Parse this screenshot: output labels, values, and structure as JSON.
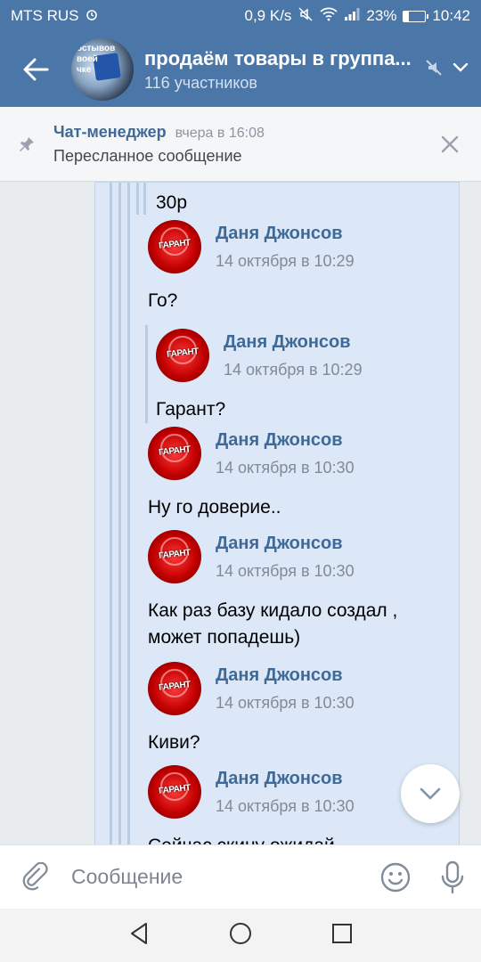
{
  "status_bar": {
    "carrier": "MTS RUS",
    "speed": "0,9 K/s",
    "battery": "23%",
    "battery_level": 0.23,
    "time": "10:42"
  },
  "header": {
    "title": "продаём товары в группа...",
    "subtitle": "116 участников",
    "avatar_text": "остывов\nвоей\nчке"
  },
  "pinned": {
    "author": "Чат-менеджер",
    "time": "вчера в 16:08",
    "text": "Пересланное сообщение"
  },
  "avatar_label": "ГАРАНТ",
  "messages": [
    {
      "text": "30р"
    },
    {
      "author": "Даня Джонсов",
      "time": "14 октября в 10:29",
      "text": "Го?"
    },
    {
      "author": "Даня Джонсов",
      "time": "14 октября в 10:29",
      "text": "Гарант?"
    },
    {
      "author": "Даня Джонсов",
      "time": "14 октября в 10:30",
      "text": "Ну го доверие.."
    },
    {
      "author": "Даня Джонсов",
      "time": "14 октября в 10:30",
      "text_line1": "Как раз базу кидало создал ,",
      "text_line2": "может попадешь)"
    },
    {
      "author": "Даня Джонсов",
      "time": "14 октября в 10:30",
      "text": "Киви?"
    },
    {
      "author": "Даня Джонсов",
      "time": "14 октября в 10:30",
      "text": "Сейчас скину ожидай"
    }
  ],
  "composer": {
    "placeholder": "Сообщение"
  },
  "colors": {
    "brand": "#4a76a8",
    "bubble": "#dce8f7",
    "link": "#3f6a98"
  }
}
